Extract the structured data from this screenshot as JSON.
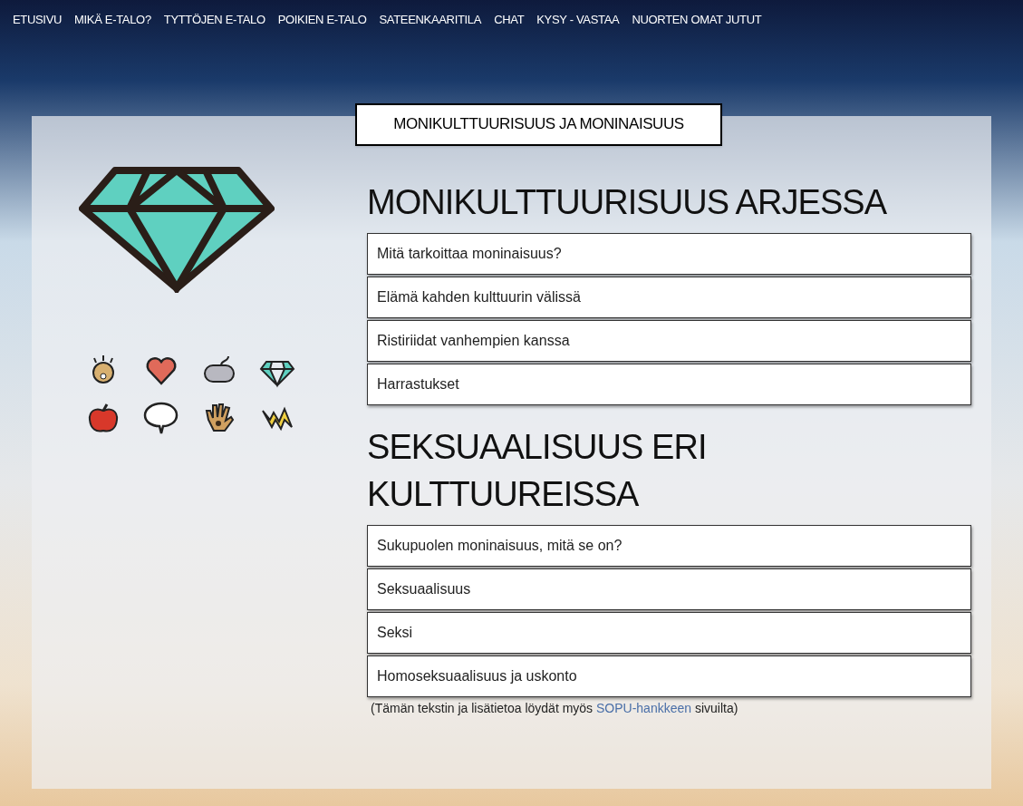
{
  "nav": [
    "ETUSIVU",
    "MIKÄ E-TALO?",
    "TYTTÖJEN E-TALO",
    "POIKIEN E-TALO",
    "SATEENKAARITILA",
    "CHAT",
    "KYSY - VASTAA",
    "NUORTEN OMAT JUTUT"
  ],
  "page_tab": "MONIKULTTUURISUUS JA MONINAISUUS",
  "sections": [
    {
      "heading": "MONIKULTTUURISUUS ARJESSA",
      "links": [
        "Mitä tarkoittaa moninaisuus?",
        "Elämä kahden kulttuurin välissä",
        "Ristiriidat vanhempien kanssa",
        "Harrastukset"
      ]
    },
    {
      "heading": "SEKSUAALISUUS ERI KULTTUUREISSA",
      "links": [
        "Sukupuolen moninaisuus, mitä se on?",
        "Seksuaalisuus",
        "Seksi",
        "Homoseksuaalisuus ja uskonto"
      ]
    }
  ],
  "footnote": {
    "before": "(Tämän tekstin ja lisätietoa löydät myös",
    "link": "SOPU-hankkeen",
    "after": "sivuilta)"
  }
}
